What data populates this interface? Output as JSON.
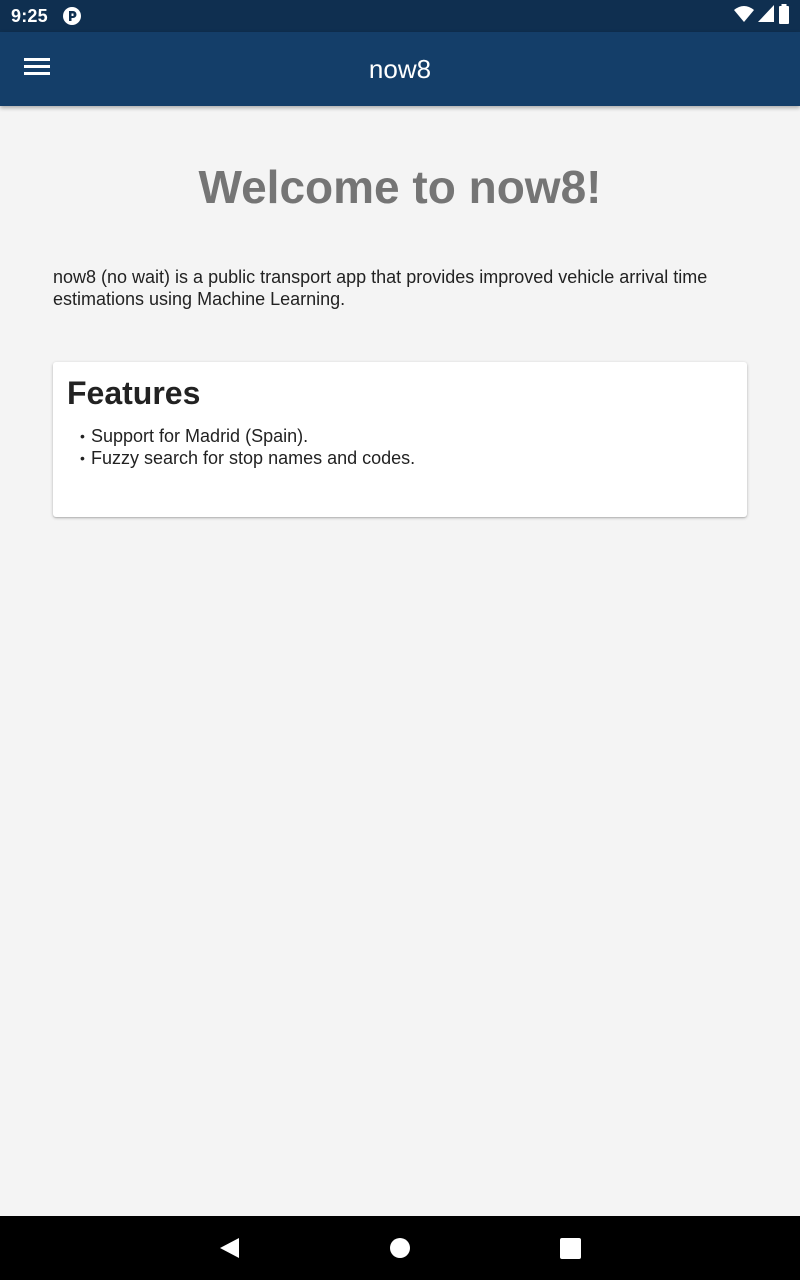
{
  "status_bar": {
    "time": "9:25",
    "icons": [
      "app-notification-icon",
      "wifi-icon",
      "signal-icon",
      "battery-icon"
    ]
  },
  "app_bar": {
    "title": "now8",
    "menu_icon": "hamburger-menu-icon"
  },
  "main": {
    "welcome_title": "Welcome to now8!",
    "intro": "now8 (no wait) is a public transport app that provides improved vehicle arrival time estimations using Machine Learning.",
    "features": {
      "title": "Features",
      "items": [
        "Support for Madrid (Spain).",
        "Fuzzy search for stop names and codes."
      ]
    }
  },
  "nav_bar": {
    "icons": [
      "back-icon",
      "home-icon",
      "recents-icon"
    ]
  },
  "colors": {
    "status_bar": "#0f2f50",
    "app_bar": "#143e69",
    "background": "#f4f4f4",
    "card": "#ffffff",
    "welcome_text": "#757575",
    "body_text": "#222222",
    "nav_bar": "#000000"
  }
}
